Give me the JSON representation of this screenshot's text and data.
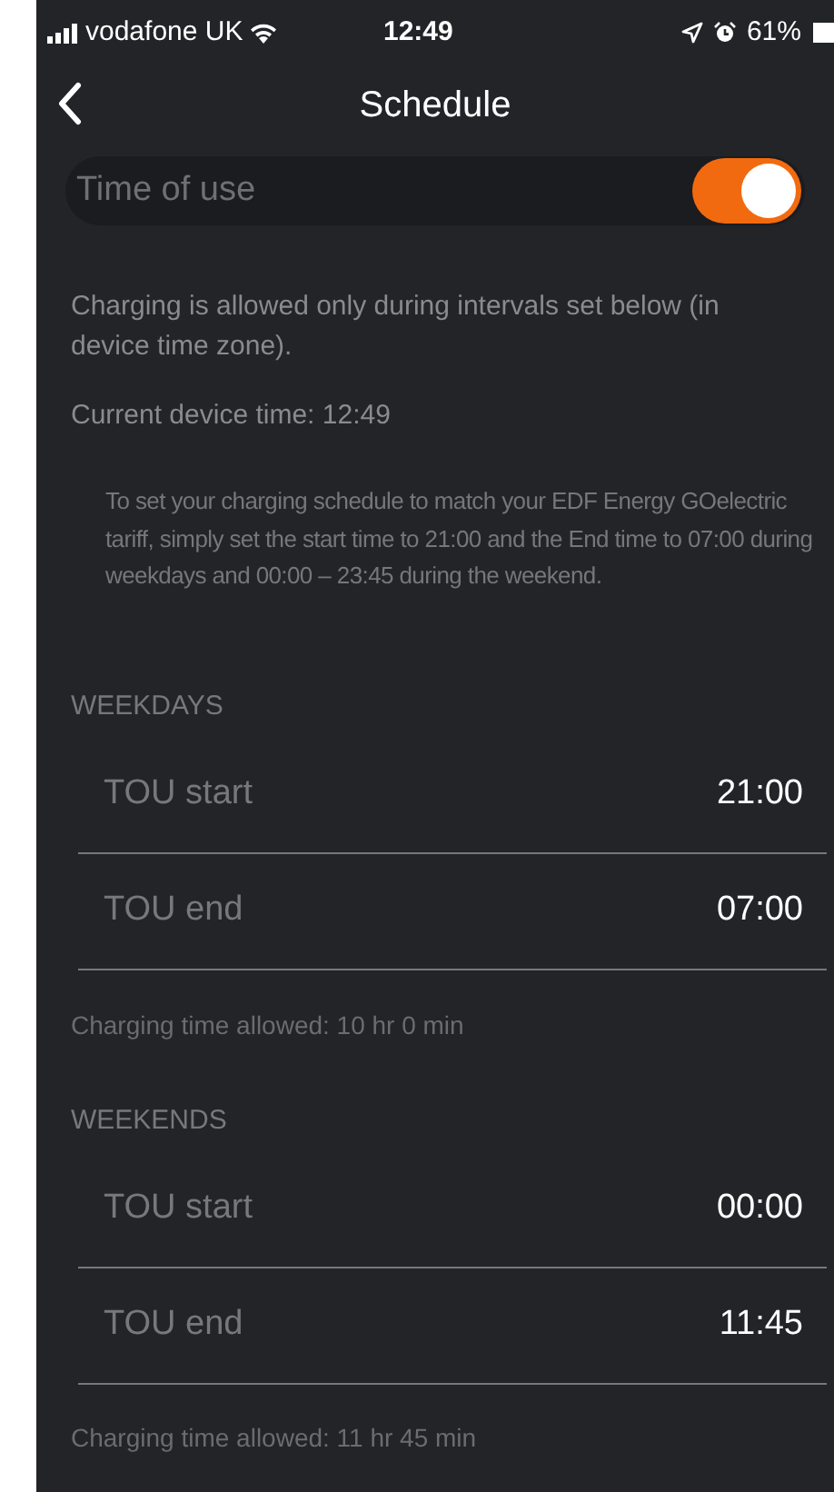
{
  "status_bar": {
    "carrier": "vodafone UK",
    "time": "12:49",
    "battery": "61%"
  },
  "nav": {
    "title": "Schedule"
  },
  "time_of_use": {
    "label": "Time of use",
    "on": true
  },
  "description": "Charging is allowed only during intervals set below (in device time zone).",
  "current_time": "Current device time: 12:49",
  "info": "To set your charging schedule to match your EDF Energy GOelectric tariff, simply set the start time to 21:00 and the End time to 07:00 during weekdays and 00:00 – 23:45 during the weekend.",
  "sections": [
    {
      "heading": "WEEKDAYS",
      "rows": [
        {
          "label": "TOU start",
          "value": "21:00"
        },
        {
          "label": "TOU end",
          "value": "07:00"
        }
      ],
      "summary": "Charging time allowed: 10 hr 0 min"
    },
    {
      "heading": "WEEKENDS",
      "rows": [
        {
          "label": "TOU start",
          "value": "00:00"
        },
        {
          "label": "TOU end",
          "value": "11:45"
        }
      ],
      "summary": "Charging time allowed: 11 hr 45 min"
    }
  ]
}
